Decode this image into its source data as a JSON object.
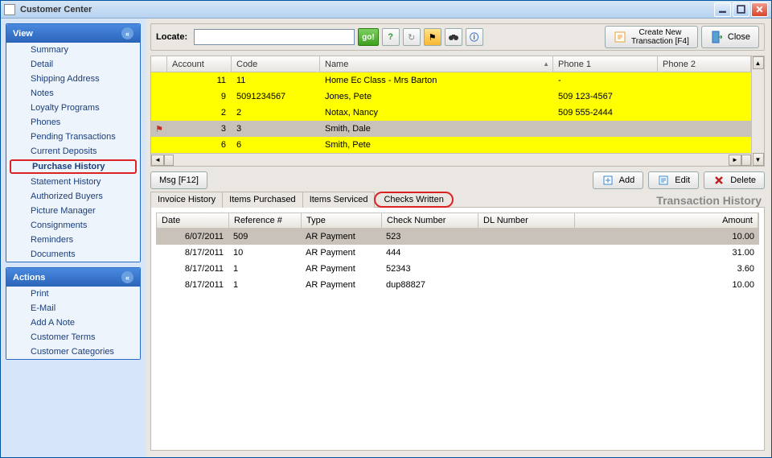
{
  "window": {
    "title": "Customer Center"
  },
  "sidebar": {
    "view": {
      "title": "View",
      "items": [
        "Summary",
        "Detail",
        "Shipping Address",
        "Notes",
        "Loyalty Programs",
        "Phones",
        "Pending Transactions",
        "Current Deposits",
        "Purchase History",
        "Statement History",
        "Authorized Buyers",
        "Picture Manager",
        "Consignments",
        "Reminders",
        "Documents"
      ],
      "selected_index": 8
    },
    "actions": {
      "title": "Actions",
      "items": [
        "Print",
        "E-Mail",
        "Add A Note",
        "Customer Terms",
        "Customer Categories"
      ]
    }
  },
  "toolbar": {
    "locate_label": "Locate:",
    "locate_value": "",
    "go_label": "go!",
    "create_new": "Create New\nTransaction [F4]",
    "close_label": "Close"
  },
  "custgrid": {
    "cols": [
      "Account",
      "Code",
      "Name",
      "Phone 1",
      "Phone 2"
    ],
    "rows": [
      {
        "account": "11",
        "code": "11",
        "name": "Home Ec Class - Mrs Barton",
        "phone1": "-",
        "phone2": "",
        "sel": false,
        "flag": false
      },
      {
        "account": "9",
        "code": "5091234567",
        "name": "Jones, Pete",
        "phone1": "509 123-4567",
        "phone2": "",
        "sel": false,
        "flag": false
      },
      {
        "account": "2",
        "code": "2",
        "name": "Notax, Nancy",
        "phone1": "509 555-2444",
        "phone2": "",
        "sel": false,
        "flag": false
      },
      {
        "account": "3",
        "code": "3",
        "name": "Smith, Dale",
        "phone1": "",
        "phone2": "",
        "sel": true,
        "flag": true
      },
      {
        "account": "6",
        "code": "6",
        "name": "Smith, Pete",
        "phone1": "",
        "phone2": "",
        "sel": false,
        "flag": false
      }
    ]
  },
  "buttons": {
    "msg": "Msg [F12]",
    "add": "Add",
    "edit": "Edit",
    "delete": "Delete"
  },
  "section_title": "Transaction History",
  "tabs": [
    "Invoice History",
    "Items Purchased",
    "Items Serviced",
    "Checks Written"
  ],
  "tab_circled_index": 3,
  "txgrid": {
    "cols": [
      "Date",
      "Reference #",
      "Type",
      "Check Number",
      "DL Number",
      "Amount"
    ],
    "rows": [
      {
        "date": "6/07/2011",
        "ref": "509",
        "type": "AR Payment",
        "check": "523",
        "dl": "",
        "amount": "10.00",
        "sel": true
      },
      {
        "date": "8/17/2011",
        "ref": "10",
        "type": "AR Payment",
        "check": "444",
        "dl": "",
        "amount": "31.00",
        "sel": false
      },
      {
        "date": "8/17/2011",
        "ref": "1",
        "type": "AR Payment",
        "check": "52343",
        "dl": "",
        "amount": "3.60",
        "sel": false
      },
      {
        "date": "8/17/2011",
        "ref": "1",
        "type": "AR Payment",
        "check": "dup88827",
        "dl": "",
        "amount": "10.00",
        "sel": false
      }
    ]
  }
}
